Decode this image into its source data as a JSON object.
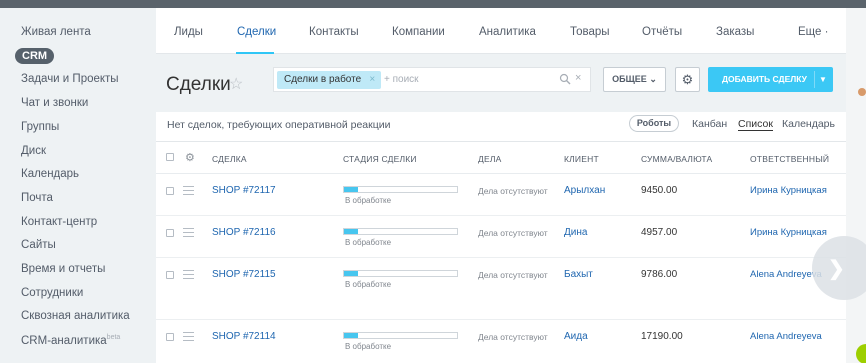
{
  "sidebar": {
    "items": [
      {
        "label": "Живая лента"
      },
      {
        "label": "CRM"
      },
      {
        "label": "Задачи и Проекты"
      },
      {
        "label": "Чат и звонки"
      },
      {
        "label": "Группы"
      },
      {
        "label": "Диск"
      },
      {
        "label": "Календарь"
      },
      {
        "label": "Почта"
      },
      {
        "label": "Контакт-центр"
      },
      {
        "label": "Сайты"
      },
      {
        "label": "Время и отчеты"
      },
      {
        "label": "Сотрудники"
      },
      {
        "label": "Сквозная аналитика"
      },
      {
        "label": "CRM-аналитика",
        "badge": "beta"
      }
    ]
  },
  "tabs": [
    {
      "label": "Лиды"
    },
    {
      "label": "Сделки"
    },
    {
      "label": "Контакты"
    },
    {
      "label": "Компании"
    },
    {
      "label": "Аналитика"
    },
    {
      "label": "Товары"
    },
    {
      "label": "Отчёты"
    },
    {
      "label": "Заказы"
    },
    {
      "label": "Еще ·"
    }
  ],
  "header": {
    "title": "Сделки",
    "filter_tag": "Сделки в работе",
    "filter_close": "×",
    "search_placeholder": "+ поиск",
    "clear": "×",
    "general_label": "ОБЩЕЕ",
    "add_label": "ДОБАВИТЬ СДЕЛКУ"
  },
  "subbar": {
    "message": "Нет сделок, требующих оперативной реакции",
    "robots_label": "Роботы",
    "views": [
      "Канбан",
      "Список",
      "Календарь"
    ],
    "active_view": "Список"
  },
  "table": {
    "columns": [
      "СДЕЛКА",
      "СТАДИЯ СДЕЛКИ",
      "ДЕЛА",
      "КЛИЕНТ",
      "СУММА/ВАЛЮТА",
      "ОТВЕТСТВЕННЫЙ"
    ],
    "rows": [
      {
        "deal": "SHOP #72117",
        "stage": "В обработке",
        "stage_progress": 0.12,
        "activities": "Дела отсутствуют",
        "client": "Арылхан",
        "sum": "9450.00",
        "responsible": "Ирина Курницкая"
      },
      {
        "deal": "SHOP #72116",
        "stage": "В обработке",
        "stage_progress": 0.12,
        "activities": "Дела отсутствуют",
        "client": "Дина",
        "sum": "4957.00",
        "responsible": "Ирина Курницкая"
      },
      {
        "deal": "SHOP #72115",
        "stage": "В обработке",
        "stage_progress": 0.12,
        "activities": "Дела отсутствуют",
        "client": "Бахыт",
        "sum": "9786.00",
        "responsible": "Alena Andreyeva"
      },
      {
        "deal": "SHOP #72114",
        "stage": "В обработке",
        "stage_progress": 0.12,
        "activities": "Дела отсутствуют",
        "client": "Аида",
        "sum": "17190.00",
        "responsible": "Alena Andreyeva"
      }
    ]
  },
  "colors": {
    "accent": "#3bc8f5",
    "link": "#2067b0",
    "filter_tag": "#bfe9f7",
    "sidebar_active": "#56616b"
  },
  "icons": [
    "star-icon",
    "search-icon",
    "gear-icon",
    "chevron-down-icon",
    "menu-icon",
    "next-arrow-icon"
  ]
}
